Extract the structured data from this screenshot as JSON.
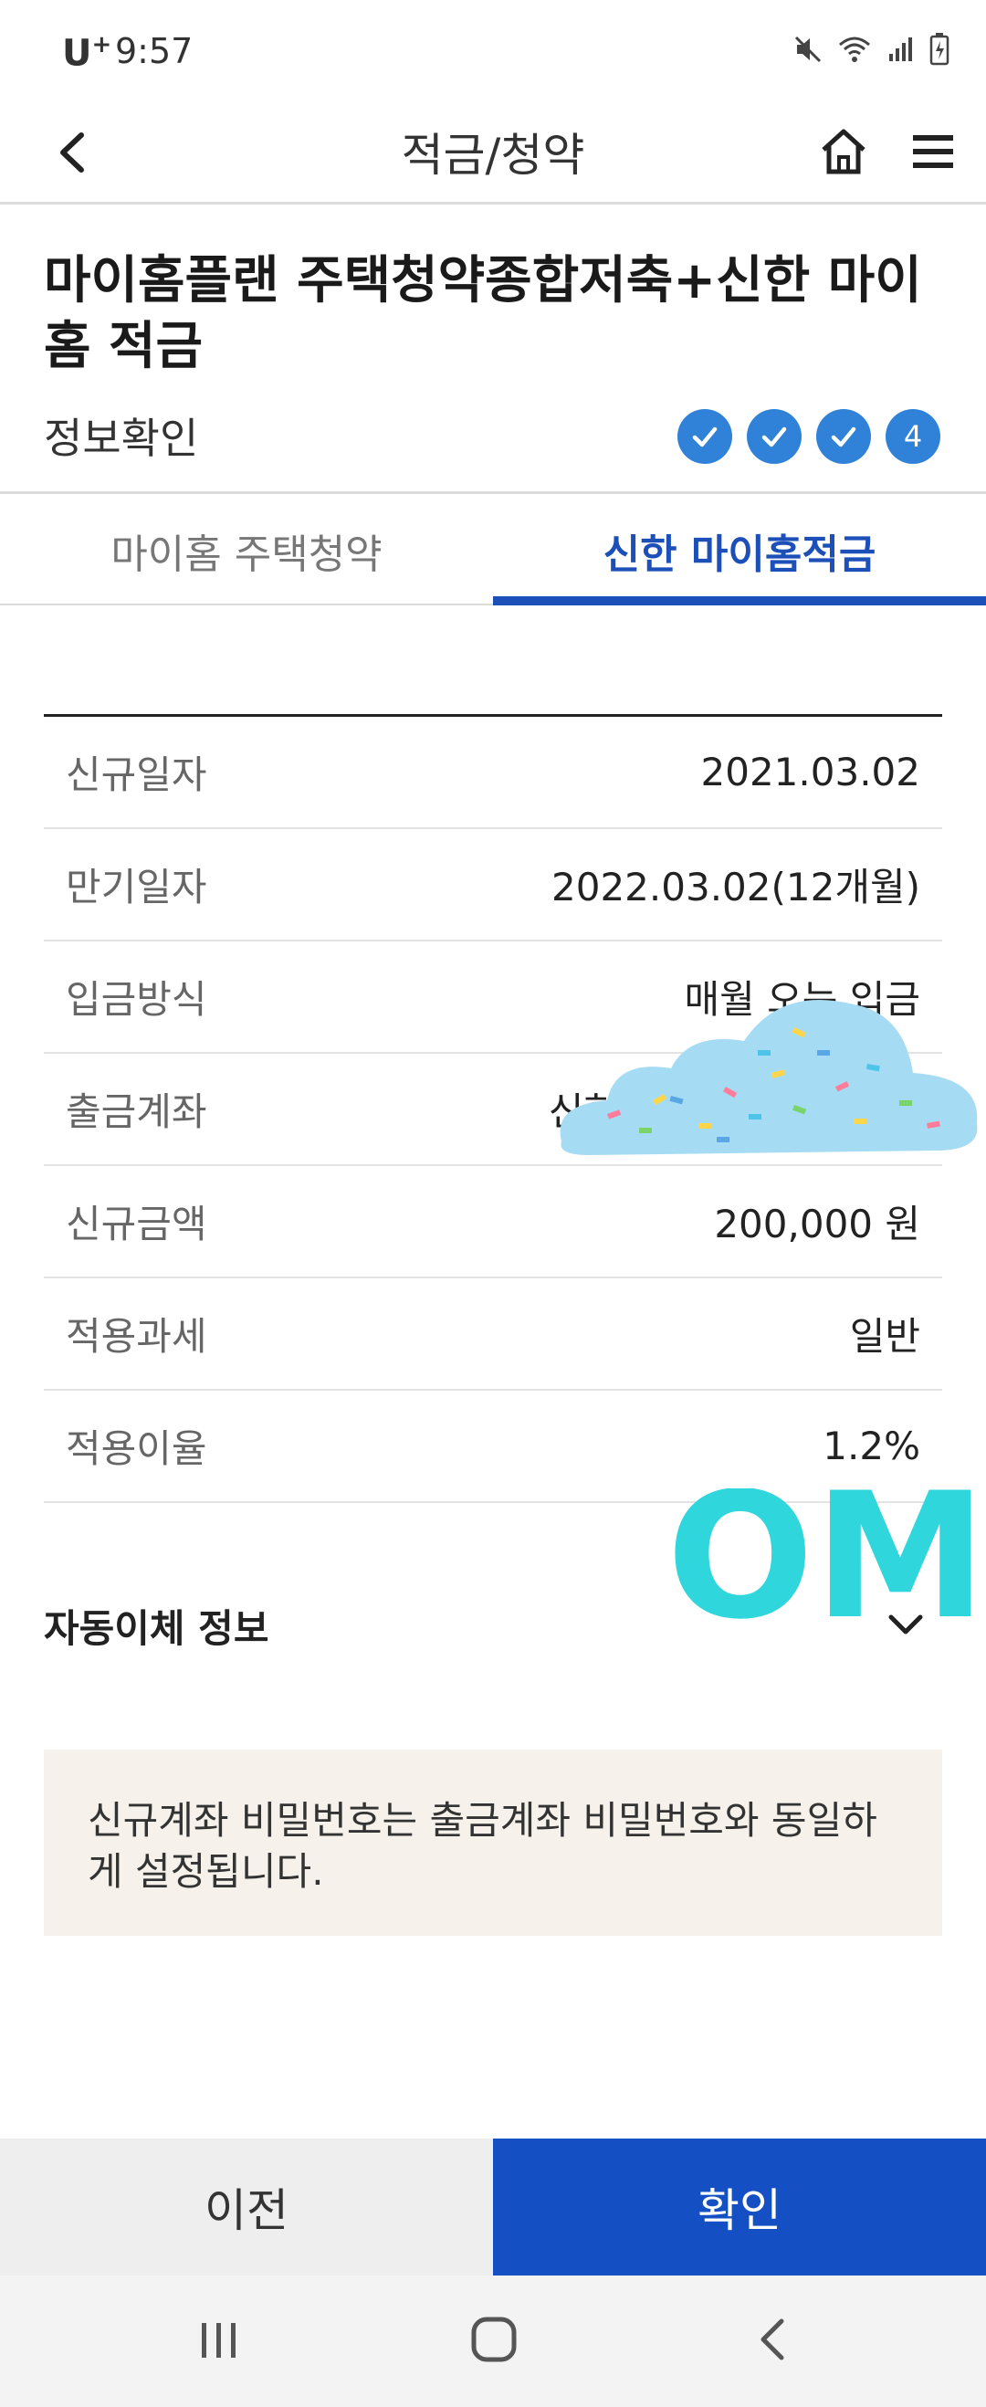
{
  "status_bar": {
    "carrier": "U",
    "carrier_sup": "+",
    "time": "9:57"
  },
  "app_bar": {
    "title": "적금/청약",
    "icons": [
      "back-arrow-icon",
      "home-icon",
      "hamburger-menu-icon"
    ]
  },
  "product": {
    "title": "마이홈플랜 주택청약종합저축+신한 마이홈 적금",
    "step_label": "정보확인",
    "steps": [
      {
        "state": "done",
        "label": ""
      },
      {
        "state": "done",
        "label": ""
      },
      {
        "state": "done",
        "label": ""
      },
      {
        "state": "current",
        "label": "4"
      }
    ]
  },
  "tabs": [
    {
      "label": "마이홈 주택청약",
      "active": false
    },
    {
      "label": "신한 마이홈적금",
      "active": true
    }
  ],
  "details": [
    {
      "label": "신규일자",
      "value": "2021.03.02"
    },
    {
      "label": "만기일자",
      "value": "2022.03.02(12개월)"
    },
    {
      "label": "입금방식",
      "value": "매월 오는 입금"
    },
    {
      "label": "출금계좌",
      "value": "신한"
    },
    {
      "label": "신규금액",
      "value": "200,000 원"
    },
    {
      "label": "적용과세",
      "value": "일반"
    },
    {
      "label": "적용이율",
      "value": "1.2%"
    }
  ],
  "auto_transfer": {
    "label": "자동이체 정보"
  },
  "notice": {
    "text": "신규계좌 비밀번호는 출금계좌 비밀번호와 동일하게 설정됩니다."
  },
  "buttons": {
    "prev": "이전",
    "confirm": "확인"
  },
  "overlays": {
    "omg_text": "OMG"
  },
  "colors": {
    "accent": "#1d4fb8",
    "button_primary": "#1450c4",
    "step_circle": "#2f82d8",
    "notice_bg": "#f6f2eb"
  }
}
